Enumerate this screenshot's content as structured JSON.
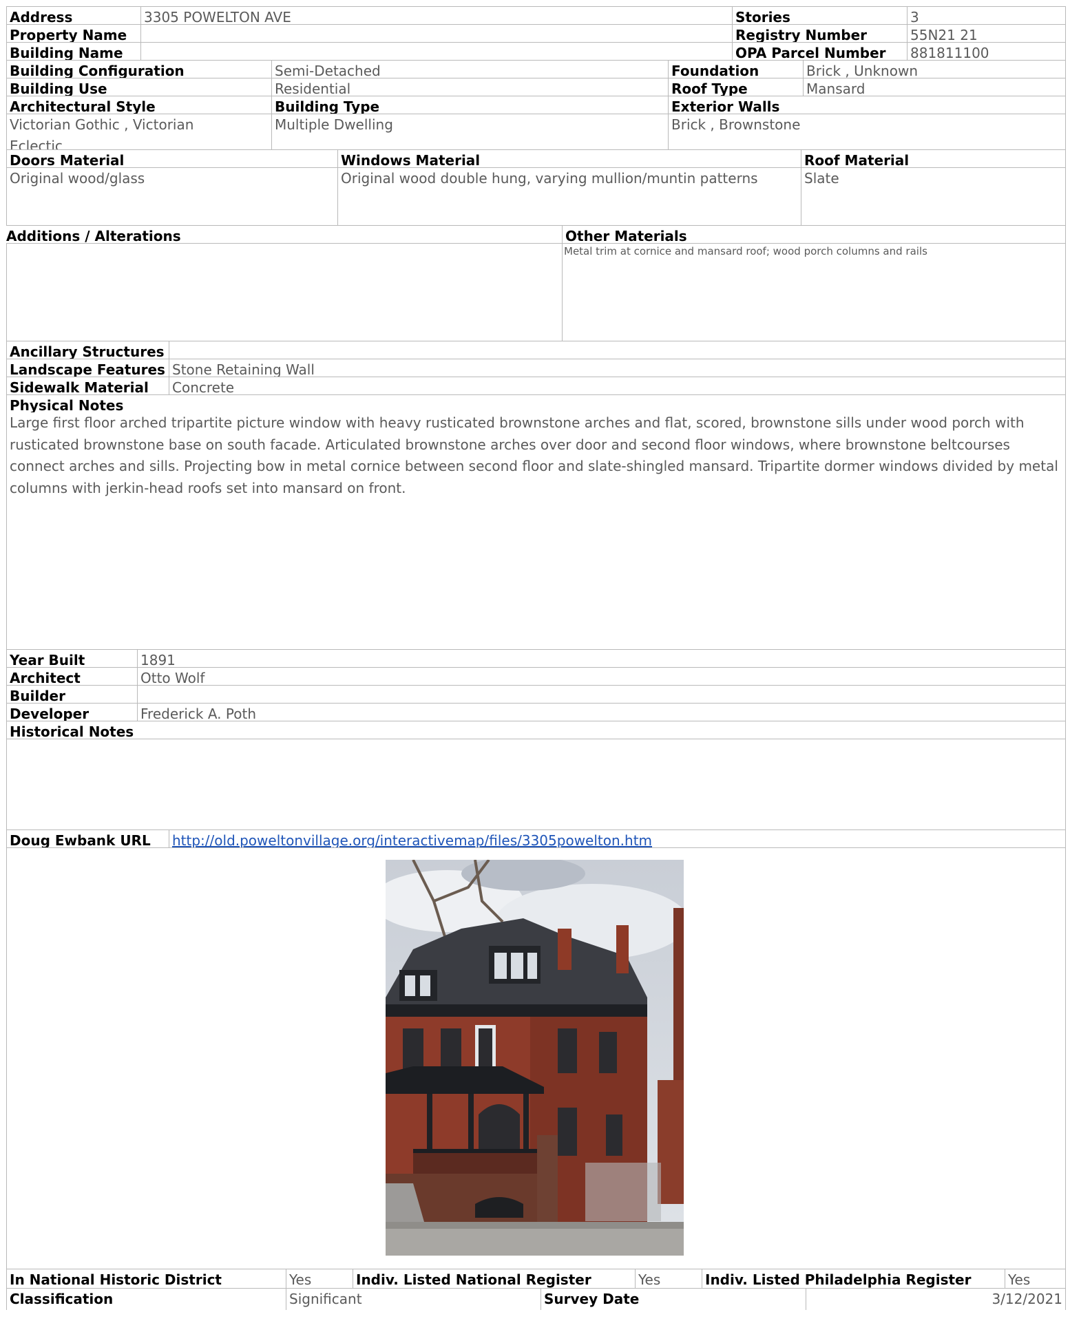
{
  "header": {
    "address_label": "Address",
    "address_value": "3305 POWELTON AVE",
    "stories_label": "Stories",
    "stories_value": "3",
    "property_name_label": "Property Name",
    "property_name_value": "",
    "registry_label": "Registry Number",
    "registry_value": "55N21 21",
    "building_name_label": "Building Name",
    "building_name_value": "",
    "opa_label": "OPA Parcel Number",
    "opa_value": "881811100"
  },
  "building": {
    "config_label": "Building Configuration",
    "config_value": "Semi-Detached",
    "foundation_label": "Foundation",
    "foundation_value": "Brick , Unknown",
    "use_label": "Building Use",
    "use_value": "Residential",
    "roof_type_label": "Roof Type",
    "roof_type_value": "Mansard",
    "arch_style_label": "Architectural Style",
    "arch_style_value": "Victorian Gothic , Victorian Eclectic",
    "building_type_label": "Building Type",
    "building_type_value": "Multiple Dwelling",
    "ext_walls_label": "Exterior Walls",
    "ext_walls_value": "Brick , Brownstone"
  },
  "materials": {
    "doors_label": "Doors Material",
    "doors_value": "Original wood/glass",
    "windows_label": "Windows Material",
    "windows_value": "Original wood double hung, varying mullion/muntin patterns",
    "roof_label": "Roof Material",
    "roof_value": "Slate",
    "additions_label": "Additions / Alterations",
    "additions_value": "",
    "other_label": "Other Materials",
    "other_value": "Metal trim at cornice and mansard roof; wood porch columns and rails"
  },
  "site": {
    "ancillary_label": "Ancillary Structures",
    "ancillary_value": "",
    "landscape_label": "Landscape Features",
    "landscape_value": "Stone Retaining Wall",
    "sidewalk_label": "Sidewalk Material",
    "sidewalk_value": "Concrete",
    "physical_notes_label": "Physical Notes",
    "physical_notes_value": "Large first floor arched tripartite picture window with heavy rusticated brownstone arches and flat, scored, brownstone sills under wood porch with rusticated brownstone base on south facade. Articulated brownstone arches over door and second floor windows, where brownstone beltcourses connect arches and sills. Projecting bow in metal cornice between second floor and slate-shingled mansard. Tripartite dormer windows divided by metal columns with jerkin-head roofs set into mansard on front."
  },
  "history": {
    "year_label": "Year Built",
    "year_value": "1891",
    "architect_label": "Architect",
    "architect_value": "Otto Wolf",
    "builder_label": "Builder",
    "builder_value": "",
    "developer_label": "Developer",
    "developer_value": "Frederick A. Poth",
    "notes_label": "Historical Notes",
    "notes_value": "",
    "url_label": "Doug Ewbank URL",
    "url_value": "http://old.poweltonvillage.org/interactivemap/files/3305powelton.htm"
  },
  "photo": {
    "subject": "three-story red brick Victorian house with slate mansard roof and front porch"
  },
  "designation": {
    "nhd_label": "In National Historic District",
    "nhd_value": "Yes",
    "nr_label": "Indiv. Listed National Register",
    "nr_value": "Yes",
    "prhp_label": "Indiv. Listed Philadelphia Register",
    "prhp_value": "Yes",
    "class_label": "Classification",
    "class_value": "Significant",
    "survey_label": "Survey Date",
    "survey_value": "3/12/2021"
  },
  "colors": {
    "border": "#b9b9b9",
    "value_text": "#5a5a5a",
    "link": "#1f55b8"
  }
}
